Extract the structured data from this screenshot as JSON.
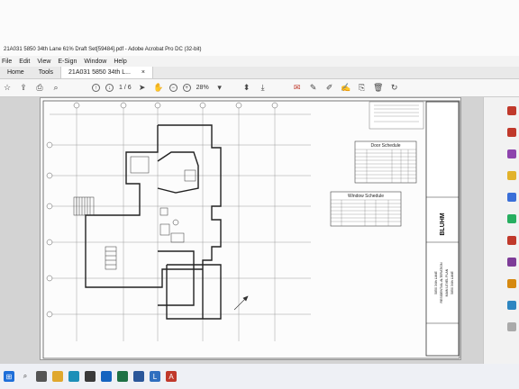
{
  "window": {
    "title": "21A031 5850 34th Lane 61% Draft Set[59484].pdf - Adobe Acrobat Pro DC (32-bit)"
  },
  "menu": [
    "File",
    "Edit",
    "View",
    "E-Sign",
    "Window",
    "Help"
  ],
  "tabs": {
    "home": "Home",
    "tools": "Tools",
    "document": "21A031 5850 34th L..."
  },
  "toolbar": {
    "page_current": "1",
    "page_total": "/ 6",
    "zoom": "28%"
  },
  "drawing": {
    "door_schedule": "Door Schedule",
    "window_schedule": "Window Schedule",
    "firm": "BLUHM",
    "title_block": [
      "5850 34th LANE",
      "RESIDENTIAL ALTERATION",
      "MAIN LEVEL PLAN",
      "5850 34th LANE"
    ]
  },
  "colors": {
    "acrobat_red": "#c0392b",
    "page_bg": "#fcfcfc",
    "toolbar_bg": "#f7f7f7",
    "taskbar_bg": "#eef0f5"
  },
  "icons": [
    "star-icon",
    "upload-icon",
    "print-icon",
    "search-icon",
    "arrow-up-icon",
    "arrow-down-icon",
    "select-cursor-icon",
    "hand-icon",
    "zoom-out-icon",
    "zoom-in-icon",
    "comment-icon",
    "pen-icon",
    "highlight-icon",
    "sign-icon",
    "stamp-icon",
    "delete-icon",
    "rotate-icon"
  ]
}
